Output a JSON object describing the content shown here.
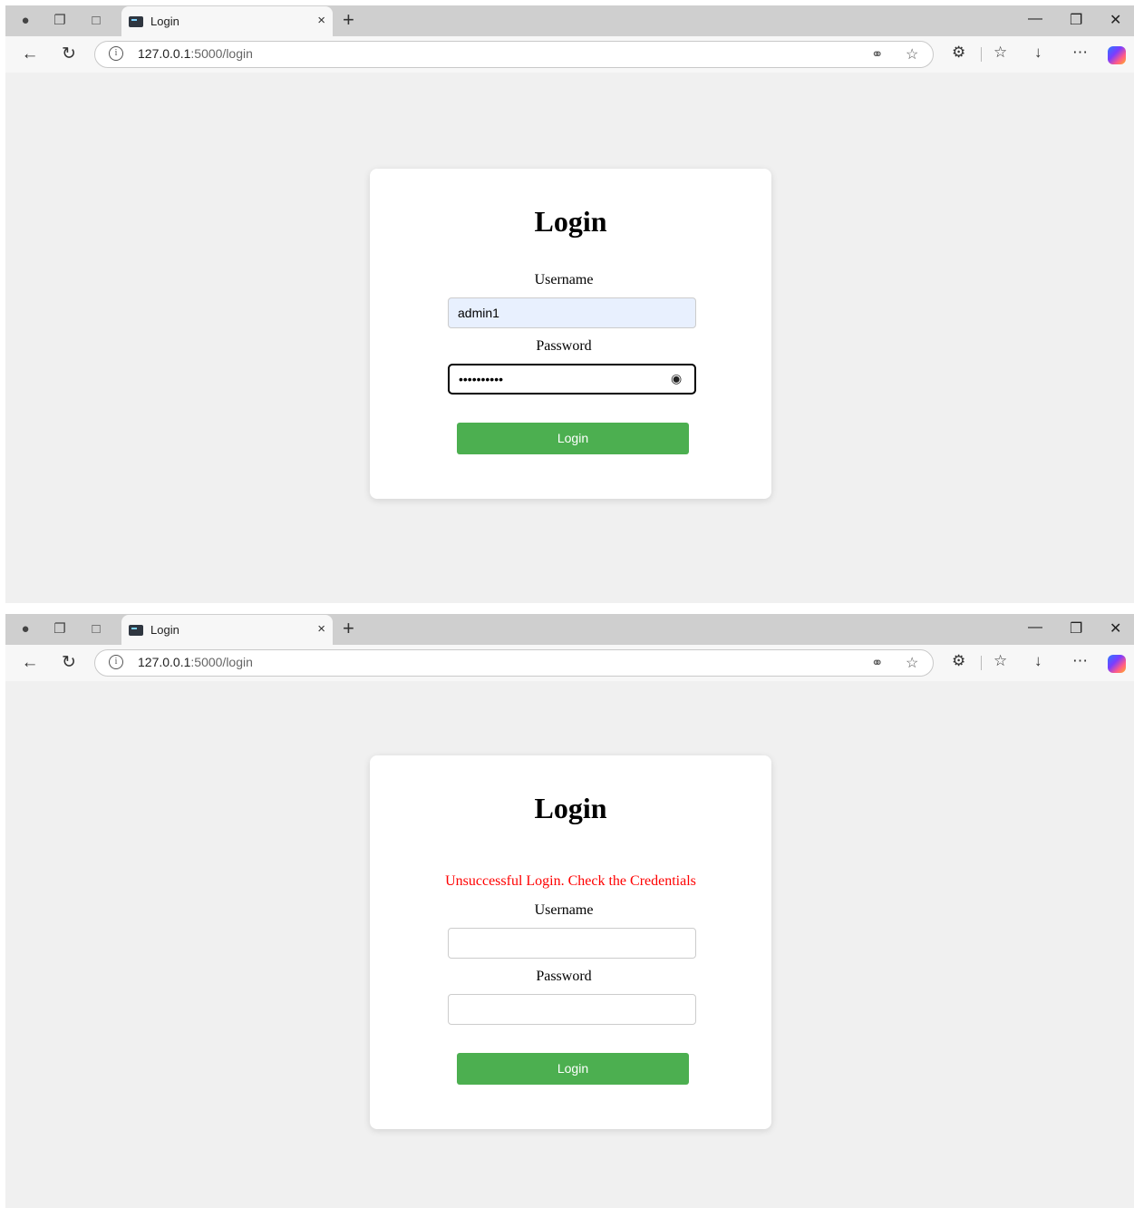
{
  "browser": {
    "tab_title": "Login",
    "tab_close": "×",
    "new_tab": "+",
    "url_host": "127.0.0.1",
    "url_path": ":5000/login",
    "info_glyph": "i",
    "icons": [
      "profile-icon",
      "workspaces-icon",
      "sidebar-icon",
      "back-icon",
      "refresh-icon",
      "key-icon",
      "star-icon",
      "extensions-icon",
      "favorites-icon",
      "download-icon",
      "more-icon",
      "copilot-icon",
      "minimize-icon",
      "restore-icon",
      "close-icon"
    ]
  },
  "screen1": {
    "title": "Login",
    "username_label": "Username",
    "username_value": "admin1",
    "password_label": "Password",
    "password_value": "••••••••••",
    "button_label": "Login"
  },
  "screen2": {
    "title": "Login",
    "error_message": "Unsuccessful Login. Check the Credentials",
    "username_label": "Username",
    "username_value": "",
    "password_label": "Password",
    "password_value": "",
    "button_label": "Login"
  },
  "colors": {
    "button": "#4caf50",
    "error": "#ff0000",
    "page_bg": "#f0f0f0",
    "autofill": "#e8f0fe"
  }
}
